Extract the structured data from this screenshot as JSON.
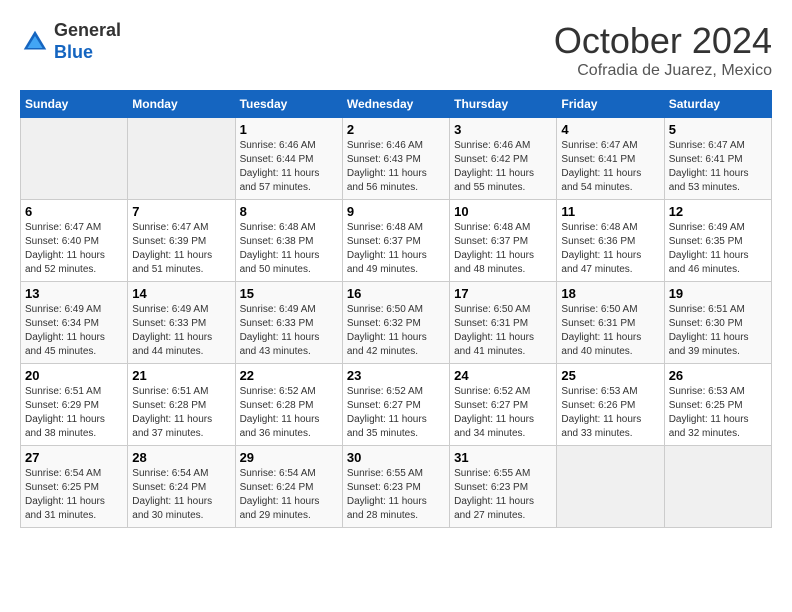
{
  "header": {
    "logo_general": "General",
    "logo_blue": "Blue",
    "month_year": "October 2024",
    "location": "Cofradia de Juarez, Mexico"
  },
  "weekdays": [
    "Sunday",
    "Monday",
    "Tuesday",
    "Wednesday",
    "Thursday",
    "Friday",
    "Saturday"
  ],
  "weeks": [
    [
      {
        "day": "",
        "sunrise": "",
        "sunset": "",
        "daylight": ""
      },
      {
        "day": "",
        "sunrise": "",
        "sunset": "",
        "daylight": ""
      },
      {
        "day": "1",
        "sunrise": "Sunrise: 6:46 AM",
        "sunset": "Sunset: 6:44 PM",
        "daylight": "Daylight: 11 hours and 57 minutes."
      },
      {
        "day": "2",
        "sunrise": "Sunrise: 6:46 AM",
        "sunset": "Sunset: 6:43 PM",
        "daylight": "Daylight: 11 hours and 56 minutes."
      },
      {
        "day": "3",
        "sunrise": "Sunrise: 6:46 AM",
        "sunset": "Sunset: 6:42 PM",
        "daylight": "Daylight: 11 hours and 55 minutes."
      },
      {
        "day": "4",
        "sunrise": "Sunrise: 6:47 AM",
        "sunset": "Sunset: 6:41 PM",
        "daylight": "Daylight: 11 hours and 54 minutes."
      },
      {
        "day": "5",
        "sunrise": "Sunrise: 6:47 AM",
        "sunset": "Sunset: 6:41 PM",
        "daylight": "Daylight: 11 hours and 53 minutes."
      }
    ],
    [
      {
        "day": "6",
        "sunrise": "Sunrise: 6:47 AM",
        "sunset": "Sunset: 6:40 PM",
        "daylight": "Daylight: 11 hours and 52 minutes."
      },
      {
        "day": "7",
        "sunrise": "Sunrise: 6:47 AM",
        "sunset": "Sunset: 6:39 PM",
        "daylight": "Daylight: 11 hours and 51 minutes."
      },
      {
        "day": "8",
        "sunrise": "Sunrise: 6:48 AM",
        "sunset": "Sunset: 6:38 PM",
        "daylight": "Daylight: 11 hours and 50 minutes."
      },
      {
        "day": "9",
        "sunrise": "Sunrise: 6:48 AM",
        "sunset": "Sunset: 6:37 PM",
        "daylight": "Daylight: 11 hours and 49 minutes."
      },
      {
        "day": "10",
        "sunrise": "Sunrise: 6:48 AM",
        "sunset": "Sunset: 6:37 PM",
        "daylight": "Daylight: 11 hours and 48 minutes."
      },
      {
        "day": "11",
        "sunrise": "Sunrise: 6:48 AM",
        "sunset": "Sunset: 6:36 PM",
        "daylight": "Daylight: 11 hours and 47 minutes."
      },
      {
        "day": "12",
        "sunrise": "Sunrise: 6:49 AM",
        "sunset": "Sunset: 6:35 PM",
        "daylight": "Daylight: 11 hours and 46 minutes."
      }
    ],
    [
      {
        "day": "13",
        "sunrise": "Sunrise: 6:49 AM",
        "sunset": "Sunset: 6:34 PM",
        "daylight": "Daylight: 11 hours and 45 minutes."
      },
      {
        "day": "14",
        "sunrise": "Sunrise: 6:49 AM",
        "sunset": "Sunset: 6:33 PM",
        "daylight": "Daylight: 11 hours and 44 minutes."
      },
      {
        "day": "15",
        "sunrise": "Sunrise: 6:49 AM",
        "sunset": "Sunset: 6:33 PM",
        "daylight": "Daylight: 11 hours and 43 minutes."
      },
      {
        "day": "16",
        "sunrise": "Sunrise: 6:50 AM",
        "sunset": "Sunset: 6:32 PM",
        "daylight": "Daylight: 11 hours and 42 minutes."
      },
      {
        "day": "17",
        "sunrise": "Sunrise: 6:50 AM",
        "sunset": "Sunset: 6:31 PM",
        "daylight": "Daylight: 11 hours and 41 minutes."
      },
      {
        "day": "18",
        "sunrise": "Sunrise: 6:50 AM",
        "sunset": "Sunset: 6:31 PM",
        "daylight": "Daylight: 11 hours and 40 minutes."
      },
      {
        "day": "19",
        "sunrise": "Sunrise: 6:51 AM",
        "sunset": "Sunset: 6:30 PM",
        "daylight": "Daylight: 11 hours and 39 minutes."
      }
    ],
    [
      {
        "day": "20",
        "sunrise": "Sunrise: 6:51 AM",
        "sunset": "Sunset: 6:29 PM",
        "daylight": "Daylight: 11 hours and 38 minutes."
      },
      {
        "day": "21",
        "sunrise": "Sunrise: 6:51 AM",
        "sunset": "Sunset: 6:28 PM",
        "daylight": "Daylight: 11 hours and 37 minutes."
      },
      {
        "day": "22",
        "sunrise": "Sunrise: 6:52 AM",
        "sunset": "Sunset: 6:28 PM",
        "daylight": "Daylight: 11 hours and 36 minutes."
      },
      {
        "day": "23",
        "sunrise": "Sunrise: 6:52 AM",
        "sunset": "Sunset: 6:27 PM",
        "daylight": "Daylight: 11 hours and 35 minutes."
      },
      {
        "day": "24",
        "sunrise": "Sunrise: 6:52 AM",
        "sunset": "Sunset: 6:27 PM",
        "daylight": "Daylight: 11 hours and 34 minutes."
      },
      {
        "day": "25",
        "sunrise": "Sunrise: 6:53 AM",
        "sunset": "Sunset: 6:26 PM",
        "daylight": "Daylight: 11 hours and 33 minutes."
      },
      {
        "day": "26",
        "sunrise": "Sunrise: 6:53 AM",
        "sunset": "Sunset: 6:25 PM",
        "daylight": "Daylight: 11 hours and 32 minutes."
      }
    ],
    [
      {
        "day": "27",
        "sunrise": "Sunrise: 6:54 AM",
        "sunset": "Sunset: 6:25 PM",
        "daylight": "Daylight: 11 hours and 31 minutes."
      },
      {
        "day": "28",
        "sunrise": "Sunrise: 6:54 AM",
        "sunset": "Sunset: 6:24 PM",
        "daylight": "Daylight: 11 hours and 30 minutes."
      },
      {
        "day": "29",
        "sunrise": "Sunrise: 6:54 AM",
        "sunset": "Sunset: 6:24 PM",
        "daylight": "Daylight: 11 hours and 29 minutes."
      },
      {
        "day": "30",
        "sunrise": "Sunrise: 6:55 AM",
        "sunset": "Sunset: 6:23 PM",
        "daylight": "Daylight: 11 hours and 28 minutes."
      },
      {
        "day": "31",
        "sunrise": "Sunrise: 6:55 AM",
        "sunset": "Sunset: 6:23 PM",
        "daylight": "Daylight: 11 hours and 27 minutes."
      },
      {
        "day": "",
        "sunrise": "",
        "sunset": "",
        "daylight": ""
      },
      {
        "day": "",
        "sunrise": "",
        "sunset": "",
        "daylight": ""
      }
    ]
  ]
}
